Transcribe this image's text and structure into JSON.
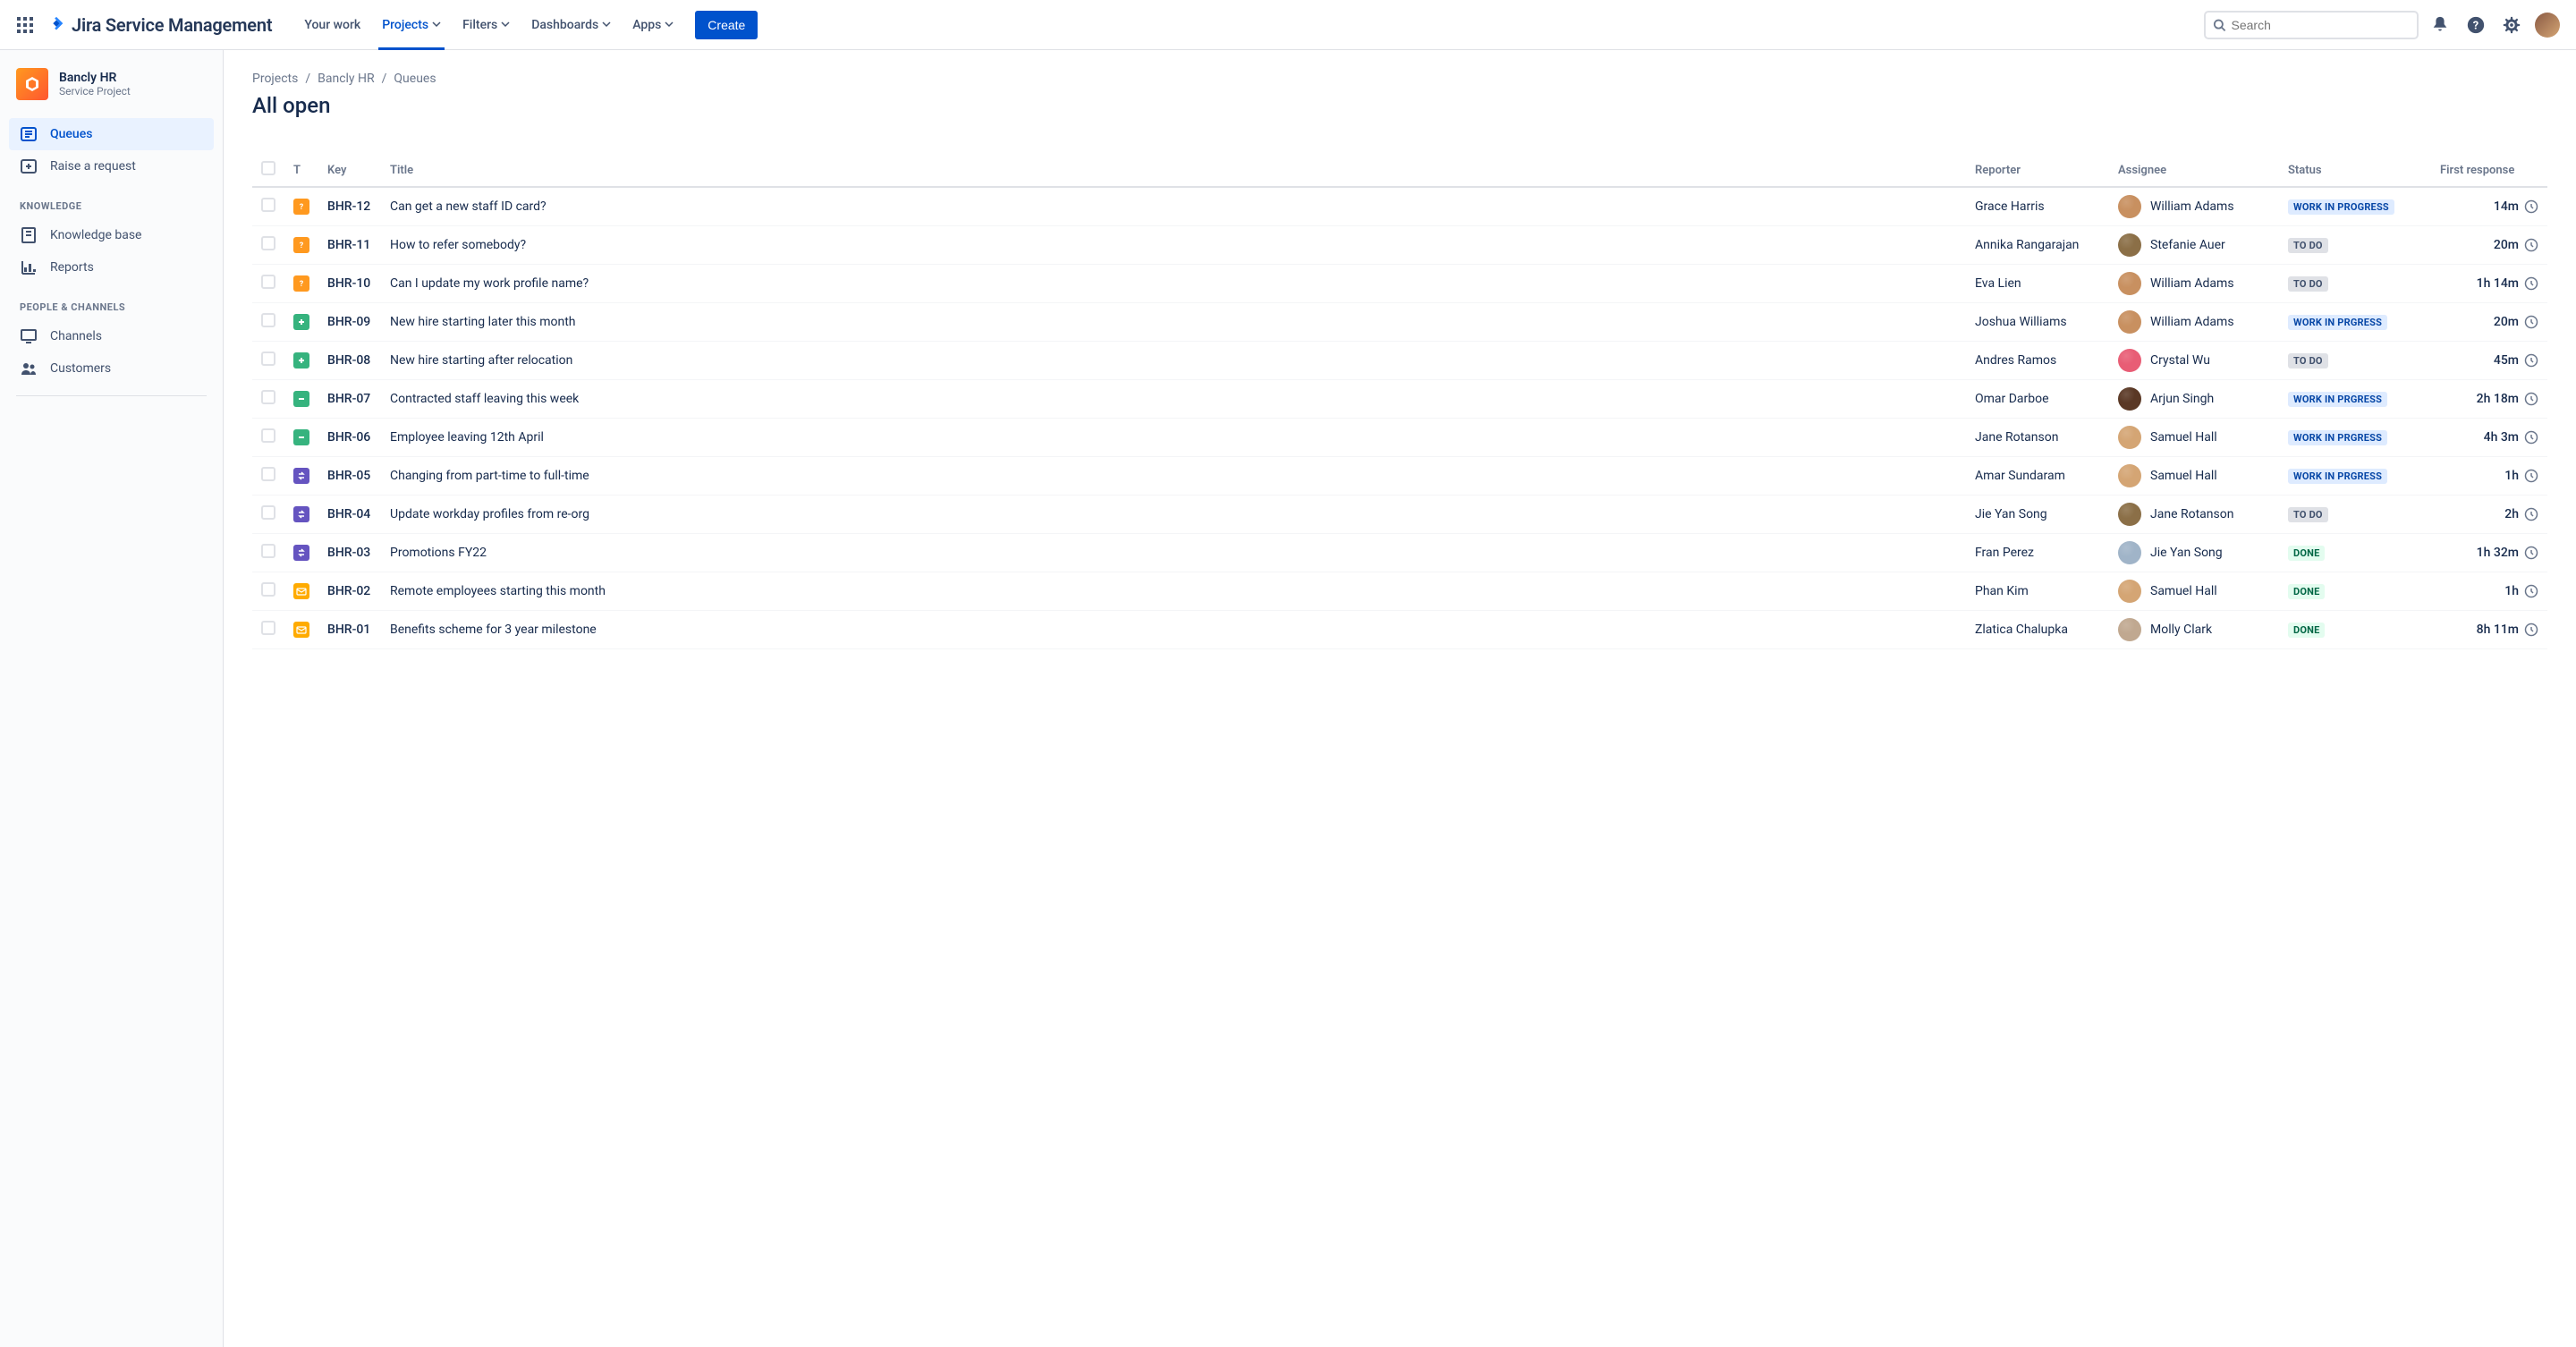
{
  "brand": {
    "name": "Jira Service Management"
  },
  "nav": {
    "your_work": "Your work",
    "projects": "Projects",
    "filters": "Filters",
    "dashboards": "Dashboards",
    "apps": "Apps",
    "create": "Create"
  },
  "search": {
    "placeholder": "Search"
  },
  "project": {
    "name": "Bancly HR",
    "type": "Service Project"
  },
  "sidebar": {
    "queues": "Queues",
    "raise": "Raise a request",
    "group_knowledge": "KNOWLEDGE",
    "kb": "Knowledge base",
    "reports": "Reports",
    "group_people": "PEOPLE & CHANNELS",
    "channels": "Channels",
    "customers": "Customers"
  },
  "breadcrumb": {
    "projects": "Projects",
    "project": "Bancly HR",
    "page": "Queues"
  },
  "page_title": "All open",
  "columns": {
    "t": "T",
    "key": "Key",
    "title": "Title",
    "reporter": "Reporter",
    "assignee": "Assignee",
    "status": "Status",
    "first_response": "First response"
  },
  "status_labels": {
    "todo": "TO DO",
    "wip": "WORK IN PROGRESS",
    "wip2": "WORK IN PRGRESS",
    "done": "DONE"
  },
  "rows": [
    {
      "type": "question",
      "key": "BHR-12",
      "title": "Can get a new staff ID card?",
      "reporter": "Grace Harris",
      "assignee": "William Adams",
      "avatar": "#c89060",
      "status": "wip",
      "status_style": "inprogress",
      "response": "14m"
    },
    {
      "type": "question",
      "key": "BHR-11",
      "title": "How to refer somebody?",
      "reporter": "Annika Rangarajan",
      "assignee": "Stefanie Auer",
      "avatar": "#8b6f47",
      "status": "todo",
      "status_style": "todo",
      "response": "20m"
    },
    {
      "type": "question",
      "key": "BHR-10",
      "title": "Can I update my work profile name?",
      "reporter": "Eva Lien",
      "assignee": "William Adams",
      "avatar": "#c89060",
      "status": "todo",
      "status_style": "todo",
      "response": "1h 14m"
    },
    {
      "type": "plus",
      "key": "BHR-09",
      "title": "New hire starting later this month",
      "reporter": "Joshua Williams",
      "assignee": "William Adams",
      "avatar": "#c89060",
      "status": "wip2",
      "status_style": "inprogress",
      "response": "20m"
    },
    {
      "type": "plus",
      "key": "BHR-08",
      "title": "New hire starting after relocation",
      "reporter": "Andres Ramos",
      "assignee": "Crystal Wu",
      "avatar": "#e85d75",
      "status": "todo",
      "status_style": "todo",
      "response": "45m"
    },
    {
      "type": "minus",
      "key": "BHR-07",
      "title": "Contracted staff leaving this week",
      "reporter": "Omar Darboe",
      "assignee": "Arjun Singh",
      "avatar": "#5a3825",
      "status": "wip2",
      "status_style": "inprogress",
      "response": "2h 18m"
    },
    {
      "type": "minus",
      "key": "BHR-06",
      "title": "Employee leaving 12th April",
      "reporter": "Jane Rotanson",
      "assignee": "Samuel Hall",
      "avatar": "#d4a574",
      "status": "wip2",
      "status_style": "inprogress",
      "response": "4h 3m"
    },
    {
      "type": "swap",
      "key": "BHR-05",
      "title": "Changing from part-time to full-time",
      "reporter": "Amar Sundaram",
      "assignee": "Samuel Hall",
      "avatar": "#d4a574",
      "status": "wip2",
      "status_style": "inprogress",
      "response": "1h"
    },
    {
      "type": "swap",
      "key": "BHR-04",
      "title": "Update workday profiles from re-org",
      "reporter": "Jie Yan Song",
      "assignee": "Jane Rotanson",
      "avatar": "#8b6f47",
      "status": "todo",
      "status_style": "todo",
      "response": "2h"
    },
    {
      "type": "swap",
      "key": "BHR-03",
      "title": "Promotions FY22",
      "reporter": "Fran Perez",
      "assignee": "Jie Yan Song",
      "avatar": "#a0b4c8",
      "status": "done",
      "status_style": "done",
      "response": "1h 32m"
    },
    {
      "type": "mail",
      "key": "BHR-02",
      "title": "Remote employees starting this month",
      "reporter": "Phan Kim",
      "assignee": "Samuel Hall",
      "avatar": "#d4a574",
      "status": "done",
      "status_style": "done",
      "response": "1h"
    },
    {
      "type": "mail",
      "key": "BHR-01",
      "title": "Benefits scheme for 3 year milestone",
      "reporter": "Zlatica Chalupka",
      "assignee": "Molly Clark",
      "avatar": "#c0a890",
      "status": "done",
      "status_style": "done",
      "response": "8h 11m"
    }
  ]
}
